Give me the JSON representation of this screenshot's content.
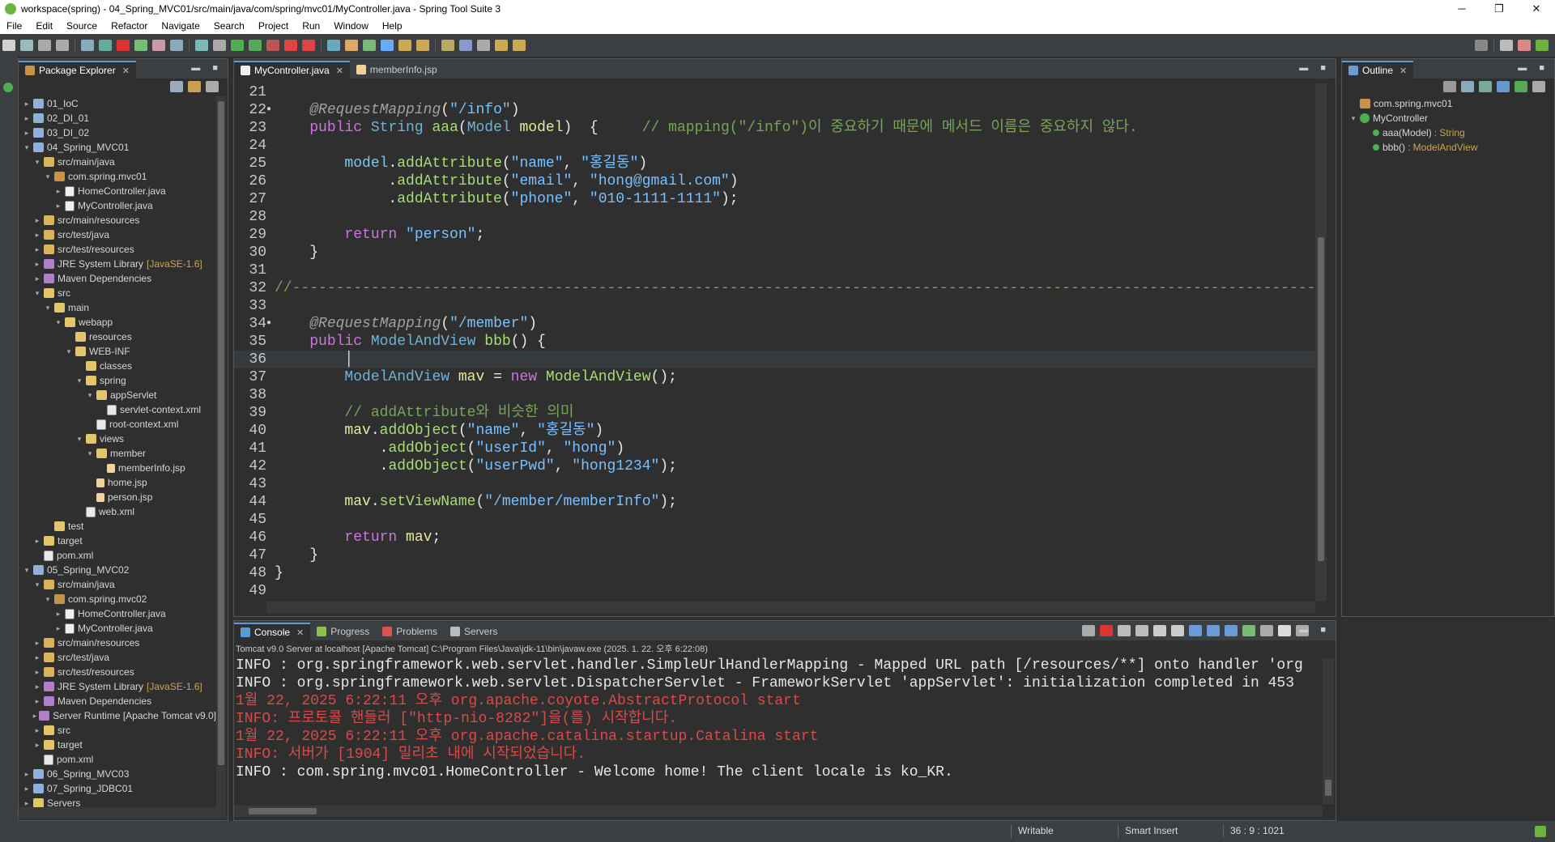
{
  "window": {
    "title": "workspace(spring) - 04_Spring_MVC01/src/main/java/com/spring/mvc01/MyController.java - Spring Tool Suite 3",
    "minimize": "─",
    "maximize": "❐",
    "close": "✕"
  },
  "menu": [
    "File",
    "Edit",
    "Source",
    "Refactor",
    "Navigate",
    "Search",
    "Project",
    "Run",
    "Window",
    "Help"
  ],
  "package_explorer": {
    "tab_label": "Package Explorer",
    "tree": [
      {
        "depth": 0,
        "tw": ">",
        "icon": "proj",
        "label": "01_IoC"
      },
      {
        "depth": 0,
        "tw": ">",
        "icon": "proj",
        "label": "02_DI_01"
      },
      {
        "depth": 0,
        "tw": ">",
        "icon": "proj",
        "label": "03_DI_02"
      },
      {
        "depth": 0,
        "tw": "v",
        "icon": "proj",
        "label": "04_Spring_MVC01"
      },
      {
        "depth": 1,
        "tw": "v",
        "icon": "srcf",
        "label": "src/main/java"
      },
      {
        "depth": 2,
        "tw": "v",
        "icon": "pkgi",
        "label": "com.spring.mvc01"
      },
      {
        "depth": 3,
        "tw": ">",
        "icon": "javaf",
        "label": "HomeController.java"
      },
      {
        "depth": 3,
        "tw": ">",
        "icon": "javaf",
        "label": "MyController.java"
      },
      {
        "depth": 1,
        "tw": ">",
        "icon": "srcf",
        "label": "src/main/resources"
      },
      {
        "depth": 1,
        "tw": ">",
        "icon": "srcf",
        "label": "src/test/java"
      },
      {
        "depth": 1,
        "tw": ">",
        "icon": "srcf",
        "label": "src/test/resources"
      },
      {
        "depth": 1,
        "tw": ">",
        "icon": "lib",
        "label": "JRE System Library",
        "suffix": "[JavaSE-1.6]"
      },
      {
        "depth": 1,
        "tw": ">",
        "icon": "lib",
        "label": "Maven Dependencies"
      },
      {
        "depth": 1,
        "tw": "v",
        "icon": "folder",
        "label": "src"
      },
      {
        "depth": 2,
        "tw": "v",
        "icon": "folder",
        "label": "main"
      },
      {
        "depth": 3,
        "tw": "v",
        "icon": "folder",
        "label": "webapp"
      },
      {
        "depth": 4,
        "tw": "",
        "icon": "folder",
        "label": "resources"
      },
      {
        "depth": 4,
        "tw": "v",
        "icon": "folder",
        "label": "WEB-INF"
      },
      {
        "depth": 5,
        "tw": "",
        "icon": "folder",
        "label": "classes"
      },
      {
        "depth": 5,
        "tw": "v",
        "icon": "folder",
        "label": "spring"
      },
      {
        "depth": 6,
        "tw": "v",
        "icon": "folder",
        "label": "appServlet"
      },
      {
        "depth": 7,
        "tw": "",
        "icon": "xmlf",
        "label": "servlet-context.xml"
      },
      {
        "depth": 6,
        "tw": "",
        "icon": "xmlf",
        "label": "root-context.xml"
      },
      {
        "depth": 5,
        "tw": "v",
        "icon": "folder",
        "label": "views"
      },
      {
        "depth": 6,
        "tw": "v",
        "icon": "folder",
        "label": "member"
      },
      {
        "depth": 7,
        "tw": "",
        "icon": "jspf",
        "label": "memberInfo.jsp"
      },
      {
        "depth": 6,
        "tw": "",
        "icon": "jspf",
        "label": "home.jsp"
      },
      {
        "depth": 6,
        "tw": "",
        "icon": "jspf",
        "label": "person.jsp"
      },
      {
        "depth": 5,
        "tw": "",
        "icon": "xmlf",
        "label": "web.xml"
      },
      {
        "depth": 2,
        "tw": "",
        "icon": "folder",
        "label": "test"
      },
      {
        "depth": 1,
        "tw": ">",
        "icon": "folder",
        "label": "target"
      },
      {
        "depth": 1,
        "tw": "",
        "icon": "xmlf",
        "label": "pom.xml"
      },
      {
        "depth": 0,
        "tw": "v",
        "icon": "proj",
        "label": "05_Spring_MVC02"
      },
      {
        "depth": 1,
        "tw": "v",
        "icon": "srcf",
        "label": "src/main/java"
      },
      {
        "depth": 2,
        "tw": "v",
        "icon": "pkgi",
        "label": "com.spring.mvc02"
      },
      {
        "depth": 3,
        "tw": ">",
        "icon": "javaf",
        "label": "HomeController.java"
      },
      {
        "depth": 3,
        "tw": ">",
        "icon": "javaf",
        "label": "MyController.java"
      },
      {
        "depth": 1,
        "tw": ">",
        "icon": "srcf",
        "label": "src/main/resources"
      },
      {
        "depth": 1,
        "tw": ">",
        "icon": "srcf",
        "label": "src/test/java"
      },
      {
        "depth": 1,
        "tw": ">",
        "icon": "srcf",
        "label": "src/test/resources"
      },
      {
        "depth": 1,
        "tw": ">",
        "icon": "lib",
        "label": "JRE System Library",
        "suffix": "[JavaSE-1.6]"
      },
      {
        "depth": 1,
        "tw": ">",
        "icon": "lib",
        "label": "Maven Dependencies"
      },
      {
        "depth": 1,
        "tw": ">",
        "icon": "lib",
        "label": "Server Runtime [Apache Tomcat v9.0]"
      },
      {
        "depth": 1,
        "tw": ">",
        "icon": "folder",
        "label": "src"
      },
      {
        "depth": 1,
        "tw": ">",
        "icon": "folder",
        "label": "target"
      },
      {
        "depth": 1,
        "tw": "",
        "icon": "xmlf",
        "label": "pom.xml"
      },
      {
        "depth": 0,
        "tw": ">",
        "icon": "proj",
        "label": "06_Spring_MVC03"
      },
      {
        "depth": 0,
        "tw": ">",
        "icon": "proj",
        "label": "07_Spring_JDBC01"
      },
      {
        "depth": 0,
        "tw": ">",
        "icon": "folder",
        "label": "Servers"
      }
    ]
  },
  "editor": {
    "tabs": [
      {
        "label": "MyController.java",
        "active": true
      },
      {
        "label": "memberInfo.jsp",
        "active": false
      }
    ],
    "lines": [
      {
        "n": "21",
        "mark": "",
        "tokens": []
      },
      {
        "n": "22",
        "mark": "●",
        "tokens": [
          [
            "    ",
            "pl"
          ],
          [
            "@RequestMapping",
            "an"
          ],
          [
            "(",
            "pl"
          ],
          [
            "\"/info\"",
            "str"
          ],
          [
            ")",
            "pl"
          ]
        ]
      },
      {
        "n": "23",
        "mark": "",
        "tokens": [
          [
            "    ",
            "pl"
          ],
          [
            "public ",
            "kw2"
          ],
          [
            "String ",
            "ty"
          ],
          [
            "aaa",
            "fn"
          ],
          [
            "(",
            "pl"
          ],
          [
            "Model ",
            "ty"
          ],
          [
            "model",
            "vr"
          ],
          [
            ")  {     ",
            "pl"
          ],
          [
            "// mapping(\"/info\")이 중요하기 때문에 메서드 이름은 중요하지 않다.",
            "cm"
          ]
        ]
      },
      {
        "n": "24",
        "mark": "",
        "tokens": []
      },
      {
        "n": "25",
        "mark": "",
        "tokens": [
          [
            "        ",
            "pl"
          ],
          [
            "model",
            "mt"
          ],
          [
            ".",
            "pl"
          ],
          [
            "addAttribute",
            "fn"
          ],
          [
            "(",
            "pl"
          ],
          [
            "\"name\"",
            "str"
          ],
          [
            ", ",
            "pl"
          ],
          [
            "\"홍길동\"",
            "str"
          ],
          [
            ")",
            "pl"
          ]
        ]
      },
      {
        "n": "26",
        "mark": "",
        "tokens": [
          [
            "             .",
            "pl"
          ],
          [
            "addAttribute",
            "fn"
          ],
          [
            "(",
            "pl"
          ],
          [
            "\"email\"",
            "str"
          ],
          [
            ", ",
            "pl"
          ],
          [
            "\"hong@gmail.com\"",
            "str"
          ],
          [
            ")",
            "pl"
          ]
        ]
      },
      {
        "n": "27",
        "mark": "",
        "tokens": [
          [
            "             .",
            "pl"
          ],
          [
            "addAttribute",
            "fn"
          ],
          [
            "(",
            "pl"
          ],
          [
            "\"phone\"",
            "str"
          ],
          [
            ", ",
            "pl"
          ],
          [
            "\"010-1111-1111\"",
            "str"
          ],
          [
            ");",
            "pl"
          ]
        ]
      },
      {
        "n": "28",
        "mark": "",
        "tokens": []
      },
      {
        "n": "29",
        "mark": "",
        "tokens": [
          [
            "        ",
            "pl"
          ],
          [
            "return ",
            "kw2"
          ],
          [
            "\"person\"",
            "str"
          ],
          [
            ";",
            "pl"
          ]
        ]
      },
      {
        "n": "30",
        "mark": "",
        "tokens": [
          [
            "    }",
            "pl"
          ]
        ]
      },
      {
        "n": "31",
        "mark": "",
        "tokens": []
      },
      {
        "n": "32",
        "mark": "",
        "tokens": [
          [
            "//--------------------------------------------------------------------------------------------------------------------------------------------------",
            "cm"
          ]
        ]
      },
      {
        "n": "33",
        "mark": "",
        "tokens": []
      },
      {
        "n": "34",
        "mark": "●",
        "tokens": [
          [
            "    ",
            "pl"
          ],
          [
            "@RequestMapping",
            "an"
          ],
          [
            "(",
            "pl"
          ],
          [
            "\"/member\"",
            "str"
          ],
          [
            ")",
            "pl"
          ]
        ]
      },
      {
        "n": "35",
        "mark": "",
        "tokens": [
          [
            "    ",
            "pl"
          ],
          [
            "public ",
            "kw2"
          ],
          [
            "ModelAndView ",
            "ty"
          ],
          [
            "bbb",
            "fn"
          ],
          [
            "() {",
            "pl"
          ]
        ]
      },
      {
        "n": "36",
        "mark": "",
        "tokens": [
          [
            "        │",
            "pl"
          ]
        ],
        "cur": true
      },
      {
        "n": "37",
        "mark": "",
        "tokens": [
          [
            "        ",
            "pl"
          ],
          [
            "ModelAndView ",
            "ty"
          ],
          [
            "mav",
            "vr"
          ],
          [
            " = ",
            "pl"
          ],
          [
            "new ",
            "kw2"
          ],
          [
            "ModelAndView",
            "fn"
          ],
          [
            "();",
            "pl"
          ]
        ]
      },
      {
        "n": "38",
        "mark": "",
        "tokens": []
      },
      {
        "n": "39",
        "mark": "",
        "tokens": [
          [
            "        ",
            "pl"
          ],
          [
            "// addAttribute와 비슷한 의미",
            "cm"
          ]
        ]
      },
      {
        "n": "40",
        "mark": "",
        "tokens": [
          [
            "        ",
            "pl"
          ],
          [
            "mav",
            "vr"
          ],
          [
            ".",
            "pl"
          ],
          [
            "addObject",
            "fn"
          ],
          [
            "(",
            "pl"
          ],
          [
            "\"name\"",
            "str"
          ],
          [
            ", ",
            "pl"
          ],
          [
            "\"홍길동\"",
            "str"
          ],
          [
            ")",
            "pl"
          ]
        ]
      },
      {
        "n": "41",
        "mark": "",
        "tokens": [
          [
            "            .",
            "pl"
          ],
          [
            "addObject",
            "fn"
          ],
          [
            "(",
            "pl"
          ],
          [
            "\"userId\"",
            "str"
          ],
          [
            ", ",
            "pl"
          ],
          [
            "\"hong\"",
            "str"
          ],
          [
            ")",
            "pl"
          ]
        ]
      },
      {
        "n": "42",
        "mark": "",
        "tokens": [
          [
            "            .",
            "pl"
          ],
          [
            "addObject",
            "fn"
          ],
          [
            "(",
            "pl"
          ],
          [
            "\"userPwd\"",
            "str"
          ],
          [
            ", ",
            "pl"
          ],
          [
            "\"hong1234\"",
            "str"
          ],
          [
            ");",
            "pl"
          ]
        ]
      },
      {
        "n": "43",
        "mark": "",
        "tokens": []
      },
      {
        "n": "44",
        "mark": "",
        "tokens": [
          [
            "        ",
            "pl"
          ],
          [
            "mav",
            "vr"
          ],
          [
            ".",
            "pl"
          ],
          [
            "setViewName",
            "fn"
          ],
          [
            "(",
            "pl"
          ],
          [
            "\"/member/memberInfo\"",
            "str"
          ],
          [
            ");",
            "pl"
          ]
        ]
      },
      {
        "n": "45",
        "mark": "",
        "tokens": []
      },
      {
        "n": "46",
        "mark": "",
        "tokens": [
          [
            "        ",
            "pl"
          ],
          [
            "return ",
            "kw2"
          ],
          [
            "mav",
            "vr"
          ],
          [
            ";",
            "pl"
          ]
        ]
      },
      {
        "n": "47",
        "mark": "",
        "tokens": [
          [
            "    }",
            "pl"
          ]
        ]
      },
      {
        "n": "48",
        "mark": "",
        "tokens": [
          [
            "}",
            "pl"
          ]
        ]
      },
      {
        "n": "49",
        "mark": "",
        "tokens": []
      }
    ]
  },
  "outline": {
    "tab_label": "Outline",
    "items": [
      {
        "depth": 0,
        "tw": "",
        "icon": "pkgi",
        "label": "com.spring.mvc01"
      },
      {
        "depth": 0,
        "tw": "v",
        "icon": "cls",
        "label": "MyController"
      },
      {
        "depth": 1,
        "tw": "",
        "icon": "meth",
        "label": "aaa(Model)",
        "suffix": ": String"
      },
      {
        "depth": 1,
        "tw": "",
        "icon": "meth",
        "label": "bbb()",
        "suffix": ": ModelAndView"
      }
    ]
  },
  "console": {
    "tabs": [
      {
        "label": "Console",
        "active": true
      },
      {
        "label": "Progress",
        "active": false
      },
      {
        "label": "Problems",
        "active": false
      },
      {
        "label": "Servers",
        "active": false
      }
    ],
    "header": "Tomcat v9.0 Server at localhost [Apache Tomcat] C:\\Program Files\\Java\\jdk-11\\bin\\javaw.exe  (2025. 1. 22. 오후 6:22:08)",
    "lines": [
      {
        "text": "INFO : org.springframework.web.servlet.handler.SimpleUrlHandlerMapping - Mapped URL path [/resources/**] onto handler 'org",
        "type": "info"
      },
      {
        "text": "INFO : org.springframework.web.servlet.DispatcherServlet - FrameworkServlet 'appServlet': initialization completed in 453",
        "type": "info"
      },
      {
        "text": "1월 22, 2025 6:22:11 오후 org.apache.coyote.AbstractProtocol start",
        "type": "err"
      },
      {
        "text": "INFO: 프로토콜 핸들러 [\"http-nio-8282\"]을(를) 시작합니다.",
        "type": "err"
      },
      {
        "text": "1월 22, 2025 6:22:11 오후 org.apache.catalina.startup.Catalina start",
        "type": "err"
      },
      {
        "text": "INFO: 서버가 [1904] 밀리초 내에 시작되었습니다.",
        "type": "err"
      },
      {
        "text": "INFO : com.spring.mvc01.HomeController - Welcome home! The client locale is ko_KR.",
        "type": "info"
      }
    ]
  },
  "status": {
    "writable": "Writable",
    "insert_mode": "Smart Insert",
    "position": "36 : 9 : 1021"
  },
  "colors": {
    "accent": "#5b9bd5",
    "spring": "#6db33f",
    "console_error": "#d94a4a"
  }
}
